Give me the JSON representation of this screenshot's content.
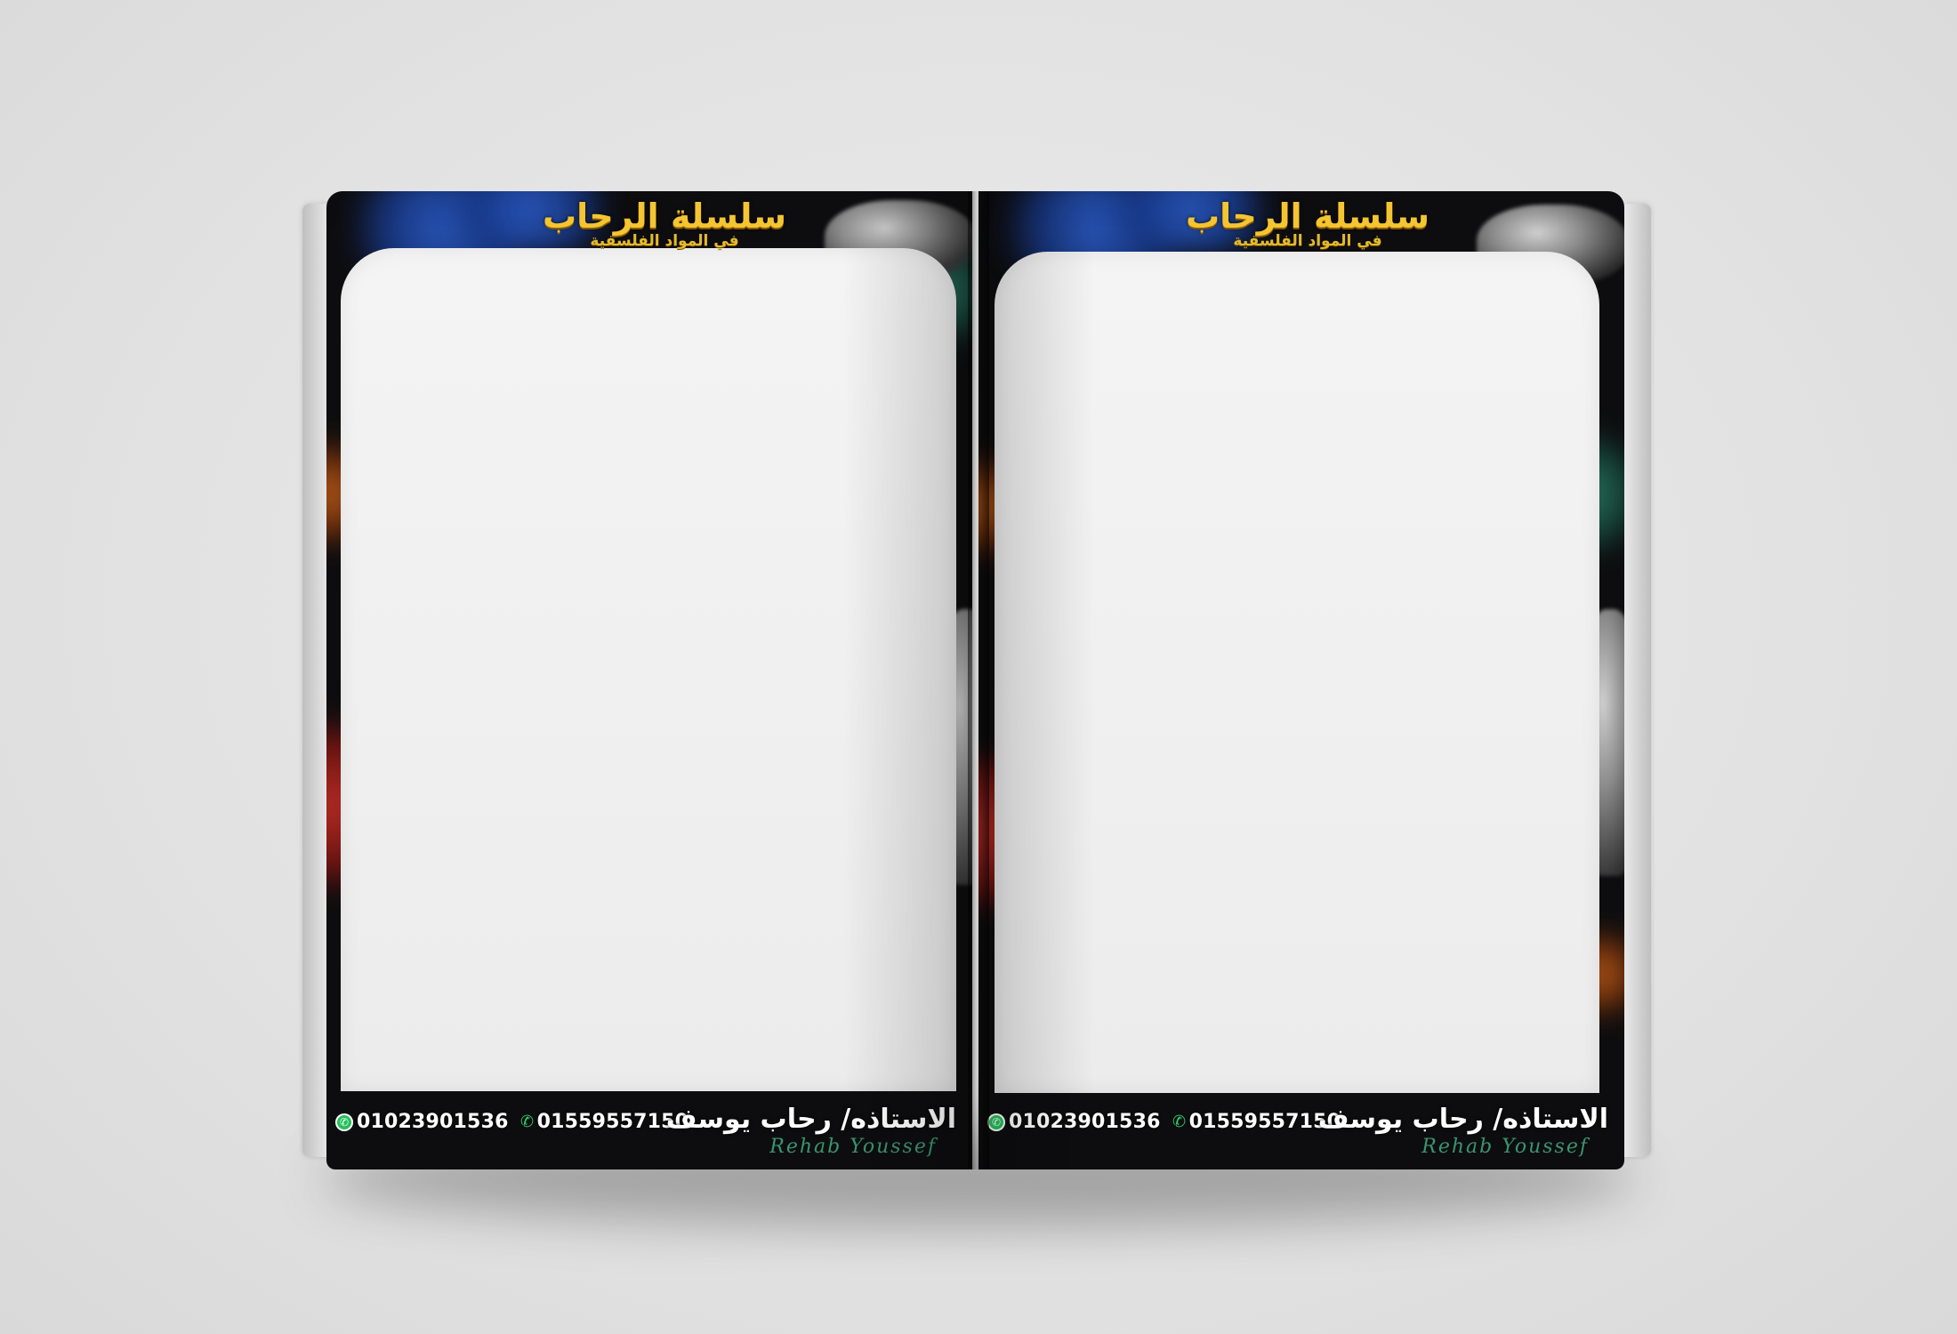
{
  "spread": {
    "left_page": {
      "title": "سلسلة الرحاب",
      "subtitle": "في المواد الفلسفية",
      "teacher": "الاستاذه/ رحاب يوسف",
      "signature": "Rehab Youssef",
      "whatsapp_number": "01023901536",
      "phone_number": "01559557150"
    },
    "right_page": {
      "title": "سلسلة الرحاب",
      "subtitle": "في المواد الفلسفية",
      "teacher": "الاستاذه/ رحاب يوسف",
      "signature": "Rehab Youssef",
      "whatsapp_number": "01023901536",
      "phone_number": "01559557150"
    }
  },
  "colors": {
    "title_gold": "#f4c531",
    "frame_dark": "#0d0d0f",
    "page_white": "#f0f0f0",
    "whatsapp_green": "#25c05a"
  },
  "icons": {
    "whatsapp": "whatsapp-icon",
    "phone": "phone-icon"
  }
}
